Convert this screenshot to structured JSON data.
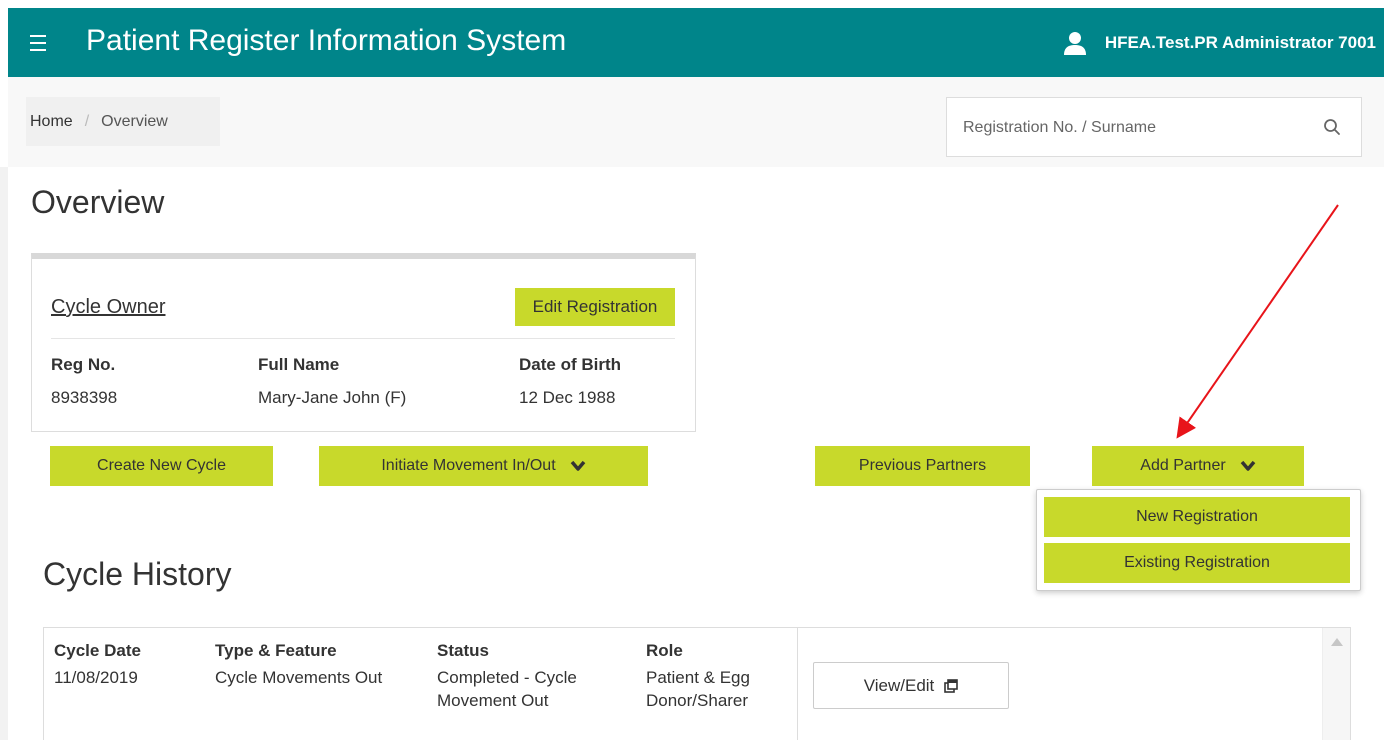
{
  "header": {
    "app_title": "Patient Register Information System",
    "user_name": "HFEA.Test.PR Administrator 7001"
  },
  "breadcrumb": {
    "home": "Home",
    "separator": "/",
    "current": "Overview"
  },
  "search": {
    "placeholder": "Registration No. / Surname"
  },
  "page_title": "Overview",
  "owner_card": {
    "link_label": "Cycle Owner",
    "edit_label": "Edit Registration",
    "columns": [
      {
        "label": "Reg No.",
        "value": "8938398"
      },
      {
        "label": "Full Name",
        "value": "Mary-Jane John (F)"
      },
      {
        "label": "Date of Birth",
        "value": "12 Dec 1988"
      }
    ]
  },
  "actions": {
    "create_cycle": "Create New Cycle",
    "initiate_movement": "Initiate Movement In/Out",
    "previous_partners": "Previous Partners",
    "add_partner": "Add Partner"
  },
  "add_partner_menu": [
    "New Registration",
    "Existing Registration"
  ],
  "cycle_history": {
    "title": "Cycle History",
    "headers": [
      "Cycle Date",
      "Type & Feature",
      "Status",
      "Role"
    ],
    "rows": [
      {
        "date": "11/08/2019",
        "type": "Cycle Movements Out",
        "status": "Completed - Cycle Movement Out",
        "role": "Patient & Egg Donor/Sharer",
        "action": "View/Edit"
      }
    ]
  },
  "colors": {
    "header_bg": "#00858a",
    "button_green": "#c8d92b",
    "annotation_arrow": "#e8141a"
  }
}
